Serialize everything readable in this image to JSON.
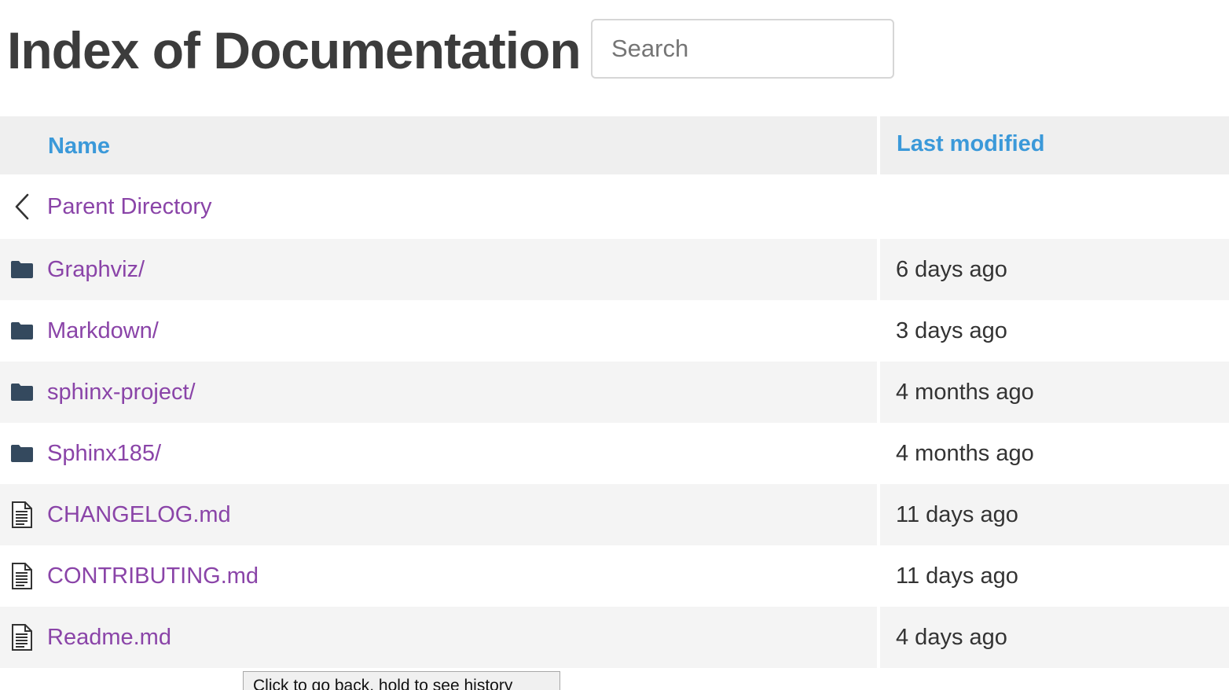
{
  "header": {
    "title": "Index of Documentation",
    "search_placeholder": "Search"
  },
  "table": {
    "columns": {
      "name": "Name",
      "last_modified": "Last modified"
    },
    "parent": {
      "label": "Parent Directory",
      "icon": "chevron-left-icon"
    },
    "rows": [
      {
        "name": "Graphviz/",
        "modified": "6 days ago",
        "icon": "folder-icon"
      },
      {
        "name": "Markdown/",
        "modified": "3 days ago",
        "icon": "folder-icon"
      },
      {
        "name": "sphinx-project/",
        "modified": "4 months ago",
        "icon": "folder-icon"
      },
      {
        "name": "Sphinx185/",
        "modified": "4 months ago",
        "icon": "folder-icon"
      },
      {
        "name": "CHANGELOG.md",
        "modified": "11 days ago",
        "icon": "file-icon"
      },
      {
        "name": "CONTRIBUTING.md",
        "modified": "11 days ago",
        "icon": "file-icon"
      },
      {
        "name": "Readme.md",
        "modified": "4 days ago",
        "icon": "file-icon"
      }
    ]
  },
  "tooltip": {
    "text": "Click to go back, hold to see history"
  },
  "colors": {
    "link": "#8a44a8",
    "header_link": "#3b99d9",
    "folder_icon": "#34495e",
    "row_alt": "#f4f4f4",
    "header_bg": "#efefef"
  }
}
